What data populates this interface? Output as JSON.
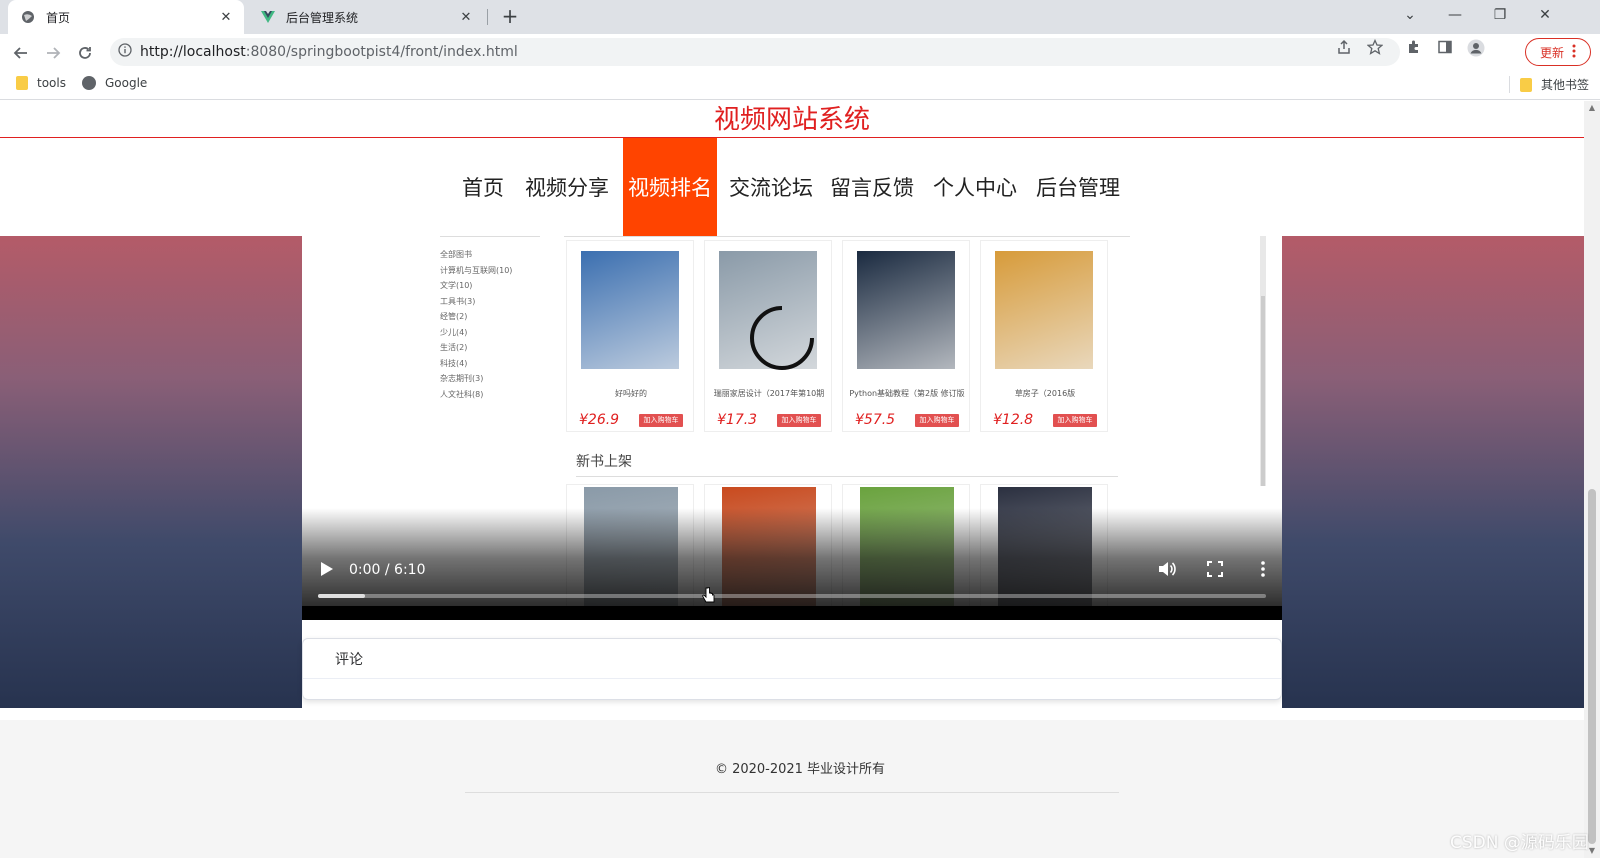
{
  "browser": {
    "tabs": [
      {
        "title": "首页",
        "active": true
      },
      {
        "title": "后台管理系统",
        "active": false
      }
    ],
    "close_glyph": "✕",
    "new_tab_glyph": "+",
    "window_controls": [
      "⌄",
      "—",
      "❐",
      "✕"
    ],
    "url_host": "http://localhost",
    "url_rest": ":8080/springbootpist4/front/index.html",
    "update_label": "更新",
    "bookmarks": [
      {
        "label": "tools",
        "icon": "folder-icon"
      },
      {
        "label": "Google",
        "icon": "globe-icon"
      }
    ],
    "other_bookmarks": "其他书签"
  },
  "site": {
    "title": "视频网站系统",
    "nav": [
      {
        "label": "首页",
        "active": false
      },
      {
        "label": "视频分享",
        "active": false
      },
      {
        "label": "视频排名",
        "active": true
      },
      {
        "label": "交流论坛",
        "active": false
      },
      {
        "label": "留言反馈",
        "active": false
      },
      {
        "label": "个人中心",
        "active": false
      },
      {
        "label": "后台管理",
        "active": false
      }
    ],
    "accent_color": "#ff4400",
    "title_color": "#e02020"
  },
  "video": {
    "time": "0:00 / 6:10",
    "progress": 0.0,
    "categories": [
      "全部图书",
      "计算机与互联网(10)",
      "文学(10)",
      "工具书(3)",
      "经管(2)",
      "少儿(4)",
      "生活(2)",
      "科技(4)",
      "杂志期刊(3)",
      "人文社科(8)"
    ],
    "books": [
      {
        "name": "好吗好的",
        "price": "¥26.9",
        "cover": "#3b6fb0"
      },
      {
        "name": "瑞丽家居设计（2017年第10期",
        "price": "¥17.3",
        "cover": "#8a9aa8"
      },
      {
        "name": "Python基础教程（第2版 修订版",
        "price": "¥57.5",
        "cover": "#1a2a40"
      },
      {
        "name": "草房子（2016版",
        "price": "¥12.8",
        "cover": "#d79b3a"
      }
    ],
    "cart_label": "加入购物车",
    "new_section": "新书上架",
    "new_covers": [
      "#8a9aa8",
      "#c94a1e",
      "#6aa33e",
      "#2b3040"
    ]
  },
  "comments": {
    "title": "评论"
  },
  "footer": {
    "copyright": "© 2020-2021 毕业设计所有"
  },
  "watermark": "CSDN @源码乐园"
}
